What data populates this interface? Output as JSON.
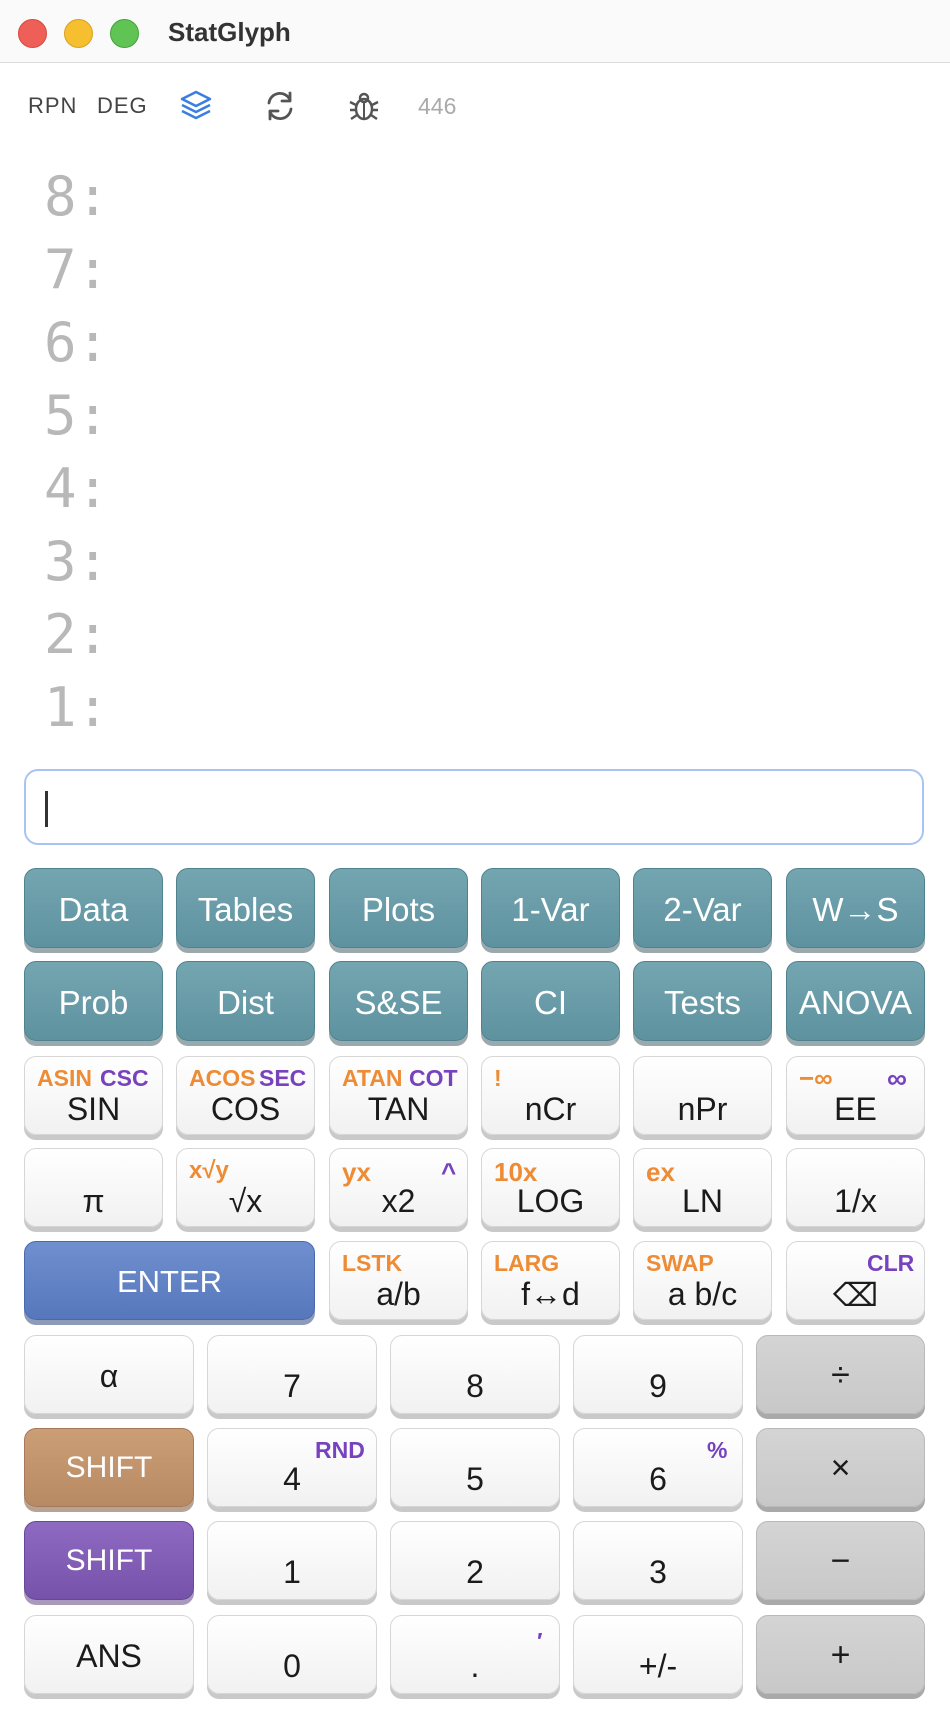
{
  "window": {
    "title": "StatGlyph"
  },
  "toolbar": {
    "mode": "RPN",
    "angle": "DEG",
    "counter": "446",
    "icons": [
      "layers-icon",
      "refresh-icon",
      "bug-icon"
    ]
  },
  "stack": {
    "labels": [
      "8:",
      "7:",
      "6:",
      "5:",
      "4:",
      "3:",
      "2:",
      "1:"
    ]
  },
  "entry": {
    "value": ""
  },
  "menu_row1": [
    "Data",
    "Tables",
    "Plots",
    "1-Var",
    "2-Var",
    "W→S"
  ],
  "menu_row2": [
    "Prob",
    "Dist",
    "S&SE",
    "CI",
    "Tests",
    "ANOVA"
  ],
  "sci_row1": [
    {
      "main": "SIN",
      "shift_orange": "ASIN",
      "shift_purple": "CSC"
    },
    {
      "main": "COS",
      "shift_orange": "ACOS",
      "shift_purple": "SEC"
    },
    {
      "main": "TAN",
      "shift_orange": "ATAN",
      "shift_purple": "COT"
    },
    {
      "main": "nCr",
      "shift_orange": "!"
    },
    {
      "main": "nPr"
    },
    {
      "main": "EE",
      "shift_orange": "−∞",
      "shift_purple": "∞"
    }
  ],
  "sci_row2": [
    {
      "main": "π"
    },
    {
      "main": "√x",
      "shift_orange": "x√y"
    },
    {
      "main": "x2",
      "shift_orange": "yx",
      "shift_purple": "^"
    },
    {
      "main": "LOG",
      "shift_orange": "10x"
    },
    {
      "main": "LN",
      "shift_orange": "ex"
    },
    {
      "main": "1/x"
    }
  ],
  "sci_row3": {
    "enter": "ENTER",
    "keys": [
      {
        "main": "a/b",
        "shift_orange": "LSTK"
      },
      {
        "main": "f↔d",
        "shift_orange": "LARG"
      },
      {
        "main": "a b/c",
        "shift_orange": "SWAP"
      },
      {
        "main": "⌫",
        "shift_purple": "CLR"
      }
    ]
  },
  "numpad": {
    "row1": [
      "α",
      "7",
      "8",
      "9",
      "÷"
    ],
    "row2": [
      "SHIFT",
      "4",
      "5",
      "6",
      "×"
    ],
    "row2_sub": {
      "key4": "RND",
      "key6": "%"
    },
    "row3": [
      "SHIFT",
      "1",
      "2",
      "3",
      "−"
    ],
    "row4": [
      "ANS",
      "0",
      ".",
      "+/-",
      "+"
    ],
    "row4_sub": {
      "dot": "′"
    }
  },
  "colors": {
    "teal": "#6a9ea9",
    "enter": "#5f80c4",
    "shift_orange": "#c0946d",
    "shift_purple": "#8460b8",
    "accent_orange": "#ee8b35",
    "accent_purple": "#7742bd"
  }
}
